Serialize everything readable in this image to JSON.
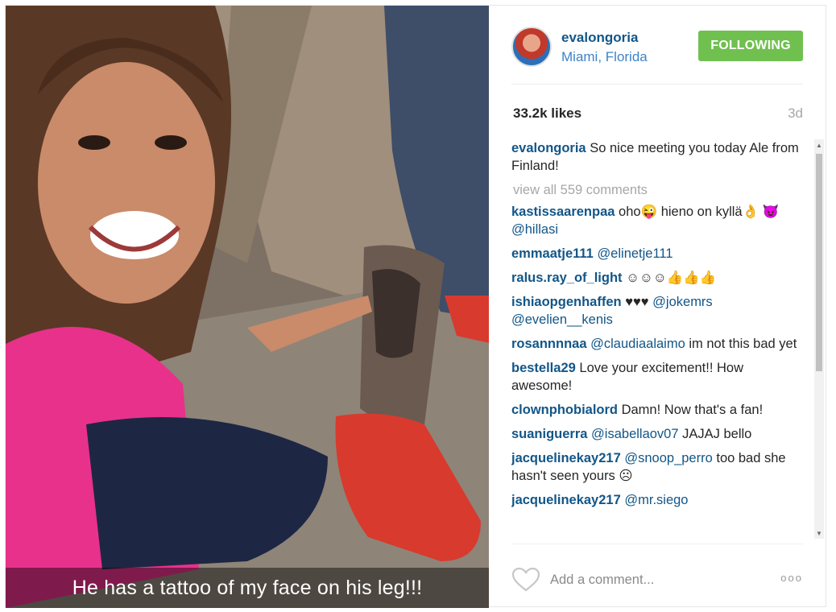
{
  "media": {
    "caption_overlay": "He has a tattoo of my face on his leg!!!"
  },
  "header": {
    "username": "evalongoria",
    "location": "Miami, Florida",
    "follow_label": "FOLLOWING"
  },
  "stats": {
    "likes": "33.2k likes",
    "age": "3d"
  },
  "caption": {
    "username": "evalongoria",
    "text": "So nice meeting you today Ale from Finland!"
  },
  "view_all": "view all 559 comments",
  "comments": [
    {
      "user": "kastissaarenpaa",
      "text": "oho😜 hieno on kyllä👌 😈",
      "mention": "@hillasi"
    },
    {
      "user": "emmaatje111",
      "mention": "@elinetje111"
    },
    {
      "user": "ralus.ray_of_light",
      "text": "☺☺☺👍👍👍"
    },
    {
      "user": "ishiaopgenhaffen",
      "text": "♥♥♥",
      "mention": "@jokemrs @evelien__kenis"
    },
    {
      "user": "rosannnnaa",
      "mention": "@claudiaalaimo",
      "text": "im not this bad yet"
    },
    {
      "user": "bestella29",
      "text": "Love your excitement!! How awesome!"
    },
    {
      "user": "clownphobialord",
      "text": "Damn! Now that's a fan!"
    },
    {
      "user": "suaniguerra",
      "mention": "@isabellaov07",
      "text": "JAJAJ bello"
    },
    {
      "user": "jacquelinekay217",
      "mention": "@snoop_perro",
      "text": "too bad she hasn't seen yours ☹"
    },
    {
      "user": "jacquelinekay217",
      "mention": "@mr.siego"
    }
  ],
  "footer": {
    "comment_placeholder": "Add a comment...",
    "more_label": "ooo"
  },
  "colors": {
    "username_blue": "#125688",
    "follow_green": "#70c050",
    "muted_gray": "#a5a7aa"
  },
  "icons": {
    "like": "heart-outline-icon",
    "more": "more-options-icon"
  }
}
